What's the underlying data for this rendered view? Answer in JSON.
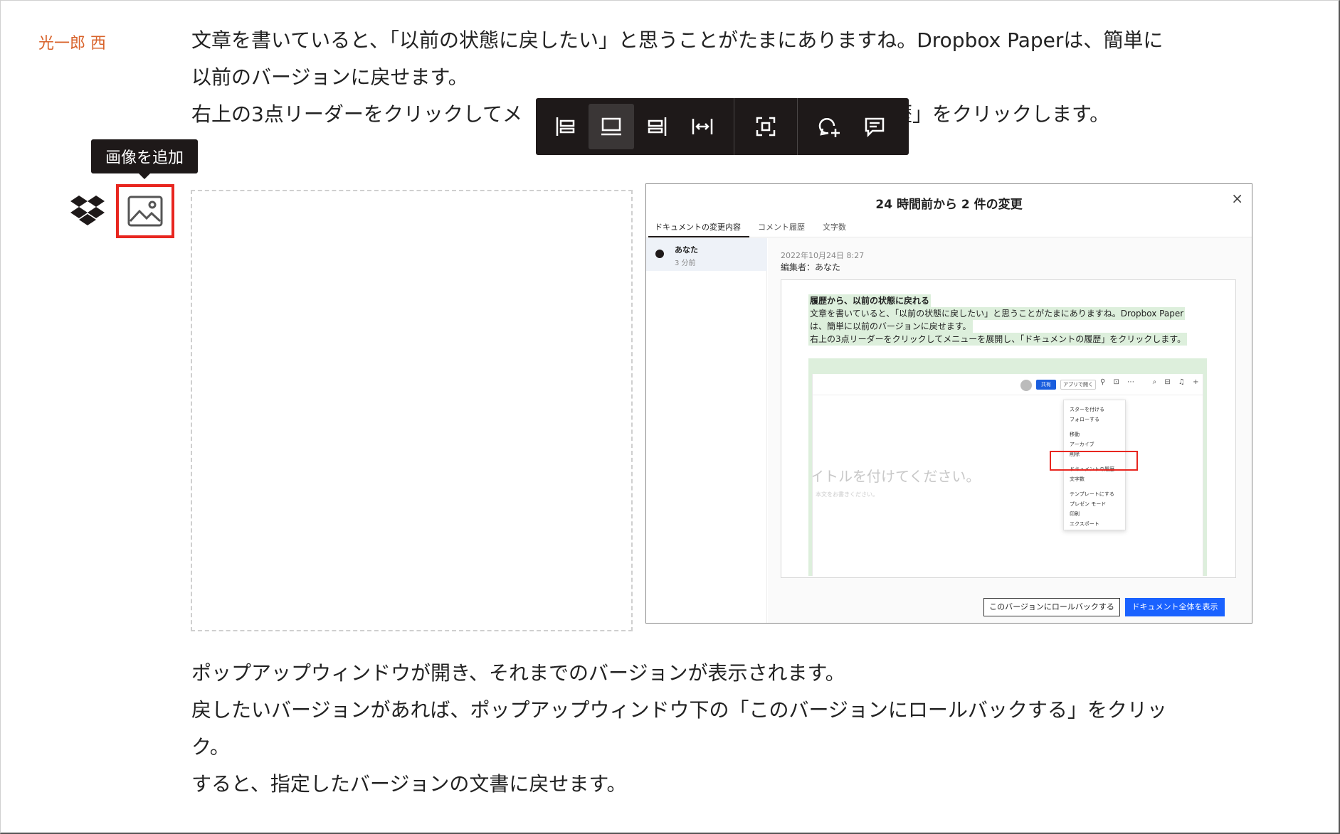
{
  "author": "光一郎 西",
  "paragraphs_top": [
    "文章を書いていると、「以前の状態に戻したい」と思うことがたまにありますね。Dropbox Paperは、簡単に",
    "以前のバージョンに戻せます。",
    "右上の3点リーダーをクリックしてメ",
    "歴」をクリックします。"
  ],
  "paragraphs_bottom": [
    "ポップアップウィンドウが開き、それまでのバージョンが表示されます。",
    "戻したいバージョンがあれば、ポップアップウィンドウ下の「このバージョンにロールバックする」をクリッ",
    "ク。",
    "すると、指定したバージョンの文書に戻せます。"
  ],
  "toolbar": {
    "buttons": [
      "align-left-icon",
      "full-width-icon",
      "align-right-icon",
      "fit-width-icon",
      "replace-image-icon",
      "add-comment-icon",
      "comment-icon"
    ]
  },
  "tooltip": "画像を追加",
  "screenshot": {
    "title": "24 時間前から 2 件の変更",
    "close": "×",
    "tabs": [
      "ドキュメントの変更内容",
      "コメント履歴",
      "文字数"
    ],
    "version_name": "あなた",
    "version_time": "3 分前",
    "date": "2022年10月24日 8:27",
    "editor": "編集者：あなた",
    "doc_lines": [
      "履歴から、以前の状態に戻れる",
      "文章を書いていると、「以前の状態に戻したい」と思うことがたまにありますね。Dropbox Paper",
      "は、簡単に以前のバージョンに戻せます。",
      "右上の3点リーダーをクリックしてメニューを展開し、「ドキュメントの履歴」をクリックします。"
    ],
    "inner": {
      "share": "共有",
      "open": "アプリで開く",
      "title_placeholder": "イトルを付けてください。",
      "body_placeholder": "本文をお書きください。",
      "menu": [
        "スターを付ける",
        "フォローする",
        "移動",
        "アーカイブ",
        "削除",
        "ドキュメントの履歴",
        "文字数",
        "テンプレートにする",
        "プレゼン モード",
        "印刷",
        "エクスポート"
      ]
    },
    "rollback_button": "このバージョンにロールバックする",
    "view_all_button": "ドキュメント全体を表示"
  }
}
